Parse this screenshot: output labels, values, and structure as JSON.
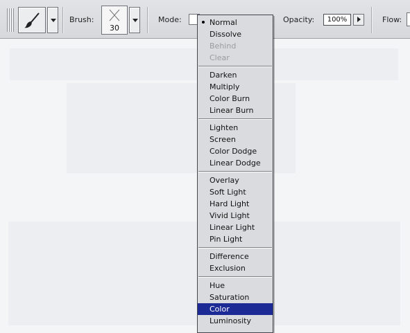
{
  "toolbar": {
    "brush_label": "Brush:",
    "brush_size": "30",
    "mode_label": "Mode:",
    "opacity_label": "Opacity:",
    "opacity_value": "100%",
    "flow_label": "Flow:"
  },
  "mode_menu": {
    "groups": [
      [
        "Normal",
        "Dissolve",
        "Behind",
        "Clear"
      ],
      [
        "Darken",
        "Multiply",
        "Color Burn",
        "Linear Burn"
      ],
      [
        "Lighten",
        "Screen",
        "Color Dodge",
        "Linear Dodge"
      ],
      [
        "Overlay",
        "Soft Light",
        "Hard Light",
        "Vivid Light",
        "Linear Light",
        "Pin Light"
      ],
      [
        "Difference",
        "Exclusion"
      ],
      [
        "Hue",
        "Saturation",
        "Color",
        "Luminosity"
      ]
    ],
    "checked_item": "Normal",
    "highlighted_item": "Color",
    "disabled_items": [
      "Behind",
      "Clear"
    ]
  },
  "icons": {
    "tool_preset": "brush-icon",
    "brush_tip": "brush-tip-icon"
  },
  "colors": {
    "menu_highlight": "#1c2a96",
    "menu_background": "#d9dbde",
    "toolbar_background": "#dcdde0"
  }
}
